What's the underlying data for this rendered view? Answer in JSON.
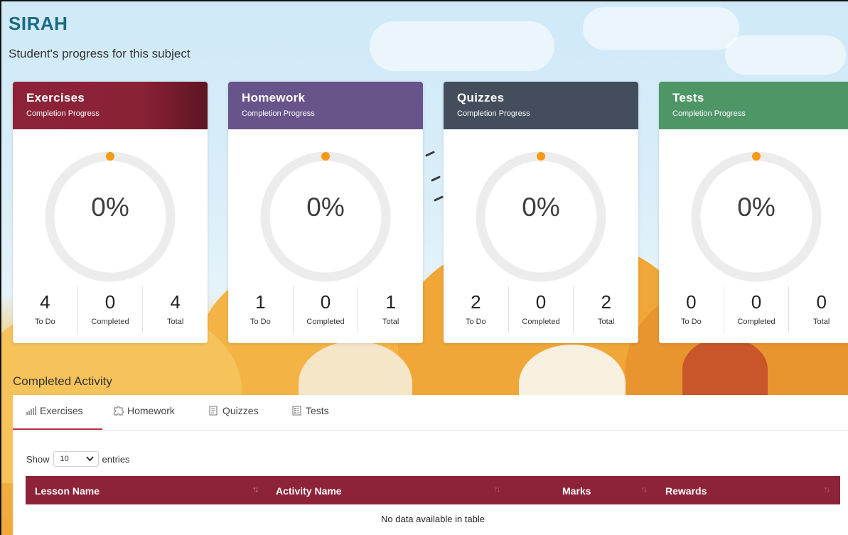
{
  "app_title": "SIRAH",
  "subtitle": "Student's progress for this subject",
  "cards": [
    {
      "title": "Exercises",
      "subtitle": "Completion Progress",
      "percent": "0%",
      "todo": "4",
      "completed": "0",
      "total": "4",
      "color": "#8c2339"
    },
    {
      "title": "Homework",
      "subtitle": "Completion Progress",
      "percent": "0%",
      "todo": "1",
      "completed": "0",
      "total": "1",
      "color": "#67548a"
    },
    {
      "title": "Quizzes",
      "subtitle": "Completion Progress",
      "percent": "0%",
      "todo": "2",
      "completed": "0",
      "total": "2",
      "color": "#434d5c"
    },
    {
      "title": "Tests",
      "subtitle": "Completion Progress",
      "percent": "0%",
      "todo": "0",
      "completed": "0",
      "total": "0",
      "color": "#4e9666"
    }
  ],
  "stat_labels": {
    "todo": "To Do",
    "completed": "Completed",
    "total": "Total"
  },
  "completed_activity": {
    "title": "Completed Activity",
    "tabs": [
      {
        "label": "Exercises",
        "icon": "bar-chart-icon",
        "active": true
      },
      {
        "label": "Homework",
        "icon": "puzzle-icon",
        "active": false
      },
      {
        "label": "Quizzes",
        "icon": "quiz-sheet-icon",
        "active": false
      },
      {
        "label": "Tests",
        "icon": "test-sheet-icon",
        "active": false
      }
    ],
    "show_label": "Show",
    "entries_value": "10",
    "entries_label": "entries",
    "columns": [
      "Lesson Name",
      "Activity Name",
      "Marks",
      "Rewards"
    ],
    "empty_message": "No data available in table"
  },
  "colors": {
    "accent": "#8c2339",
    "title": "#1c6a84",
    "progress_dot": "#f59a12",
    "ring": "#ececec"
  }
}
